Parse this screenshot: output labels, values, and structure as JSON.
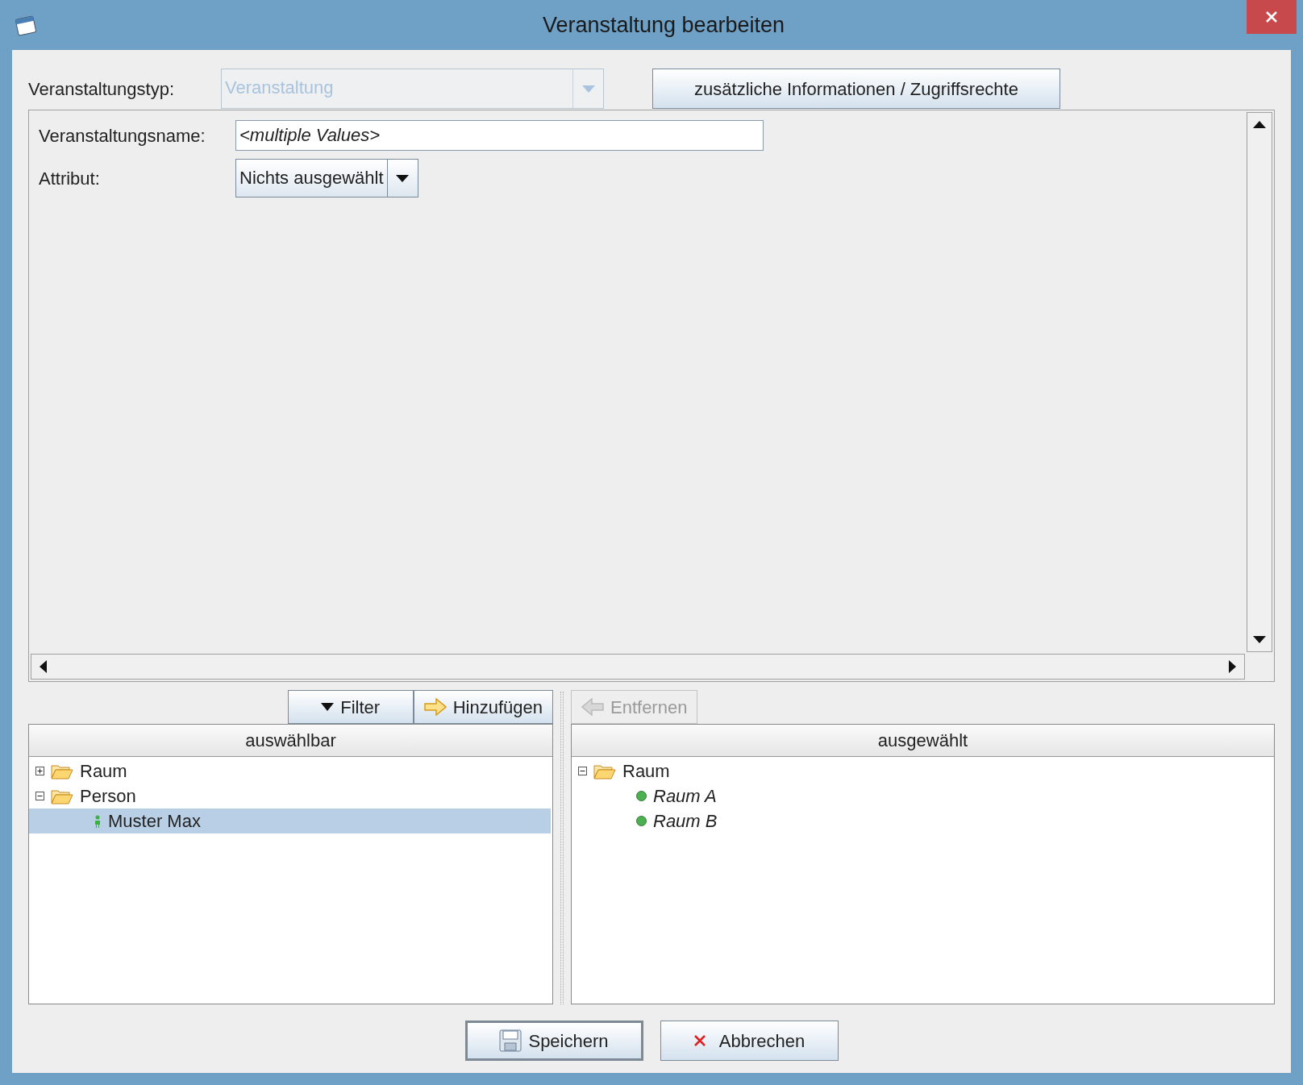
{
  "window": {
    "title": "Veranstaltung bearbeiten"
  },
  "type_field": {
    "label": "Veranstaltungstyp:",
    "value": "Veranstaltung",
    "disabled": true
  },
  "info_button": {
    "label": "zusätzliche Informationen / Zugriffsrechte"
  },
  "name_field": {
    "label": "Veranstaltungsname:",
    "value": "<multiple Values>"
  },
  "attribute": {
    "label": "Attribut:",
    "value": "Nichts ausgewählt"
  },
  "available": {
    "buttons": [
      {
        "kind": "filter",
        "label": "Filter",
        "disabled": false
      },
      {
        "kind": "add",
        "label": "Hinzufügen",
        "disabled": false
      }
    ],
    "header": "auswählbar",
    "tree": [
      {
        "kind": "folder",
        "label": "Raum",
        "expanded": false,
        "selected": false
      },
      {
        "kind": "folder",
        "label": "Person",
        "expanded": true,
        "selected": false,
        "children": [
          {
            "kind": "person",
            "label": "Muster Max",
            "selected": true
          }
        ]
      }
    ]
  },
  "chosen": {
    "buttons": [
      {
        "kind": "remove",
        "label": "Entfernen",
        "disabled": true
      }
    ],
    "header": "ausgewählt",
    "tree": [
      {
        "kind": "folder",
        "label": "Raum",
        "expanded": true,
        "selected": false,
        "children": [
          {
            "kind": "resource",
            "label": "Raum A",
            "selected": false
          },
          {
            "kind": "resource",
            "label": "Raum B",
            "selected": false
          }
        ]
      }
    ]
  },
  "buttons": [
    {
      "kind": "save",
      "label": "Speichern"
    },
    {
      "kind": "cancel",
      "label": "Abbrechen"
    }
  ]
}
